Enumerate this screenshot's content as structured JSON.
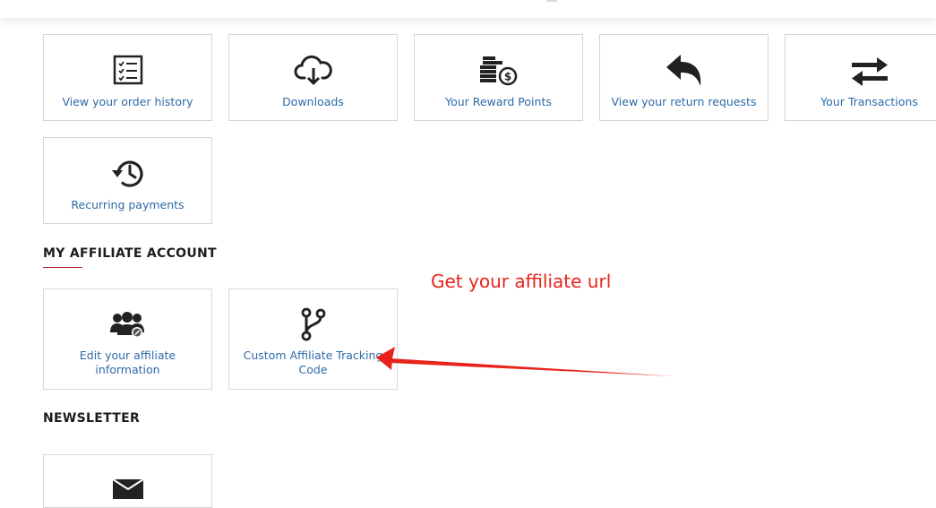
{
  "account_links": [
    {
      "label": "View your order history",
      "icon": "checklist-icon"
    },
    {
      "label": "Downloads",
      "icon": "cloud-download-icon"
    },
    {
      "label": "Your Reward Points",
      "icon": "coins-icon"
    },
    {
      "label": "View your return requests",
      "icon": "reply-icon"
    },
    {
      "label": "Your Transactions",
      "icon": "exchange-icon"
    },
    {
      "label": "Recurring payments",
      "icon": "history-icon"
    }
  ],
  "affiliate": {
    "heading": "MY AFFILIATE ACCOUNT",
    "items": [
      {
        "label": "Edit your affiliate information",
        "icon": "users-edit-icon"
      },
      {
        "label": "Custom Affiliate Tracking Code",
        "icon": "code-branch-icon"
      }
    ]
  },
  "newsletter": {
    "heading": "NEWSLETTER",
    "icon": "envelope-icon"
  },
  "annotation": {
    "text": "Get your affiliate url",
    "color": "#e8231b"
  },
  "colors": {
    "link": "#2d6aa8",
    "border": "#d6d6d6",
    "heading_accent": "#b3262c"
  }
}
